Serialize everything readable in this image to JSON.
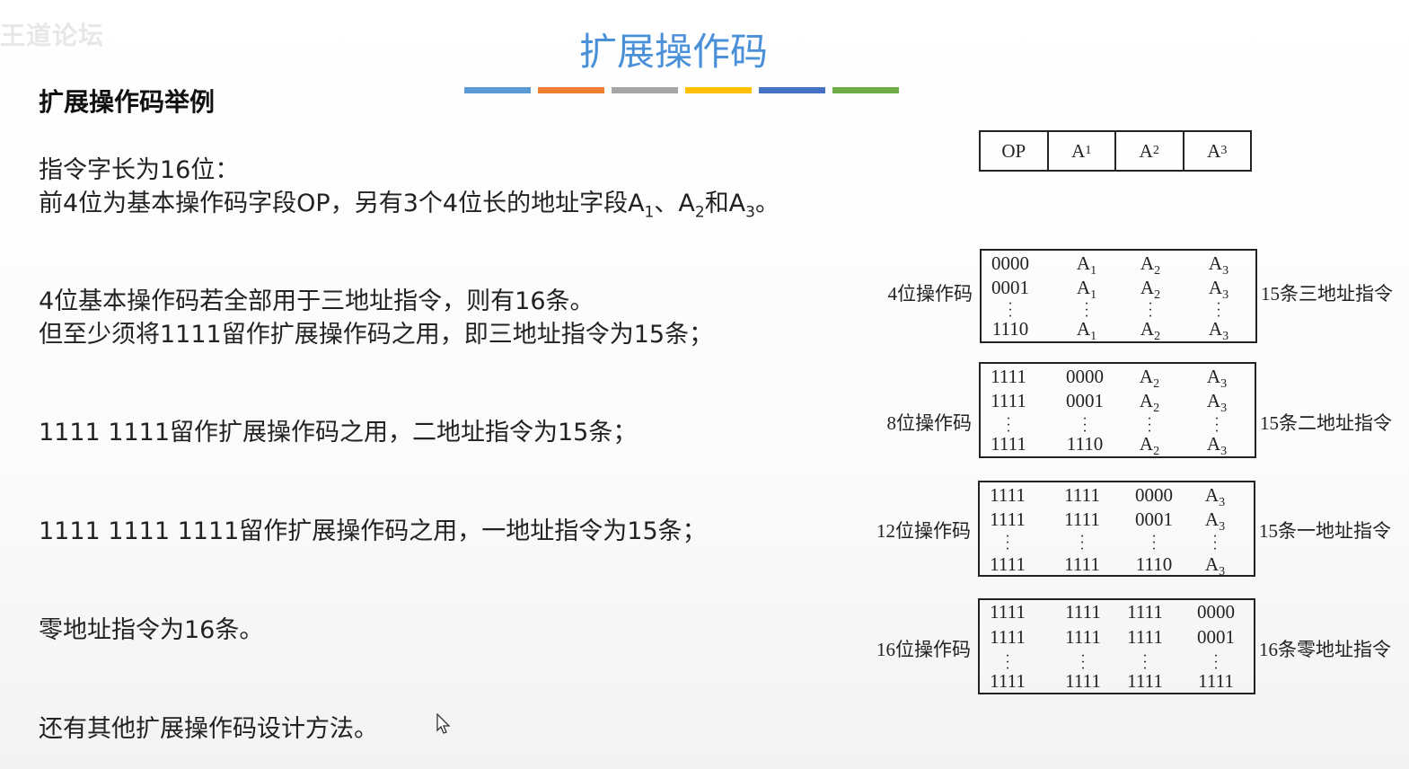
{
  "watermark": "王道论坛",
  "title": "扩展操作码",
  "stripe_colors": [
    "#5b9bd5",
    "#ed7d31",
    "#a5a5a5",
    "#ffc000",
    "#4472c4",
    "#70ad47"
  ],
  "subtitle": "扩展操作码举例",
  "text": {
    "l1": "指令字长为16位：",
    "l2a": "前4位为基本操作码字段OP，另有3个4位长的地址字段A",
    "l2s1": "1",
    "l2b": "、A",
    "l2s2": "2",
    "l2c": "和A",
    "l2s3": "3",
    "l2d": "。",
    "l3": "4位基本操作码若全部用于三地址指令，则有16条。",
    "l4": "但至少须将1111留作扩展操作码之用，即三地址指令为15条；",
    "l5": "1111 1111留作扩展操作码之用，二地址指令为15条；",
    "l6": "1111 1111 1111留作扩展操作码之用，一地址指令为15条；",
    "l7": "零地址指令为16条。",
    "l8": "还有其他扩展操作码设计方法。"
  },
  "format": {
    "op": "OP",
    "a": "A",
    "subs": [
      "1",
      "2",
      "3"
    ]
  },
  "groups": [
    {
      "left": "4位操作码",
      "right": "15条三地址指令",
      "rows": [
        [
          "0000",
          "A1",
          "A2",
          "A3"
        ],
        [
          "0001",
          "A1",
          "A2",
          "A3"
        ],
        [
          "1110",
          "A1",
          "A2",
          "A3"
        ]
      ]
    },
    {
      "left": "8位操作码",
      "right": "15条二地址指令",
      "rows": [
        [
          "1111",
          "0000",
          "A2",
          "A3"
        ],
        [
          "1111",
          "0001",
          "A2",
          "A3"
        ],
        [
          "1111",
          "1110",
          "A2",
          "A3"
        ]
      ]
    },
    {
      "left": "12位操作码",
      "right": "15条一地址指令",
      "rows": [
        [
          "1111",
          "1111",
          "0000",
          "A3"
        ],
        [
          "1111",
          "1111",
          "0001",
          "A3"
        ],
        [
          "1111",
          "1111",
          "1110",
          "A3"
        ]
      ]
    },
    {
      "left": "16位操作码",
      "right": "16条零地址指令",
      "rows": [
        [
          "1111",
          "1111",
          "1111",
          "0000"
        ],
        [
          "1111",
          "1111",
          "1111",
          "0001"
        ],
        [
          "1111",
          "1111",
          "1111",
          "1111"
        ]
      ]
    }
  ]
}
